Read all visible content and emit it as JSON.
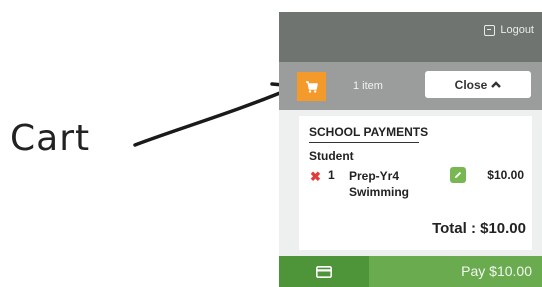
{
  "annotation": {
    "label": "Cart"
  },
  "header": {
    "logout_label": "Logout"
  },
  "cart_bar": {
    "items_count": "1 item",
    "close_label": "Close"
  },
  "cart": {
    "section_title": "SCHOOL PAYMENTS",
    "student_label": "Student",
    "items": [
      {
        "qty": "1",
        "name": "Prep-Yr4 Swimming",
        "price": "$10.00"
      }
    ],
    "total": "Total : $10.00"
  },
  "pay": {
    "label": "Pay $10.00"
  },
  "colors": {
    "cart_button": "#f39a2b",
    "pay_bar": "#6aab4f",
    "remove": "#e33b3b",
    "edit": "#78b752"
  }
}
